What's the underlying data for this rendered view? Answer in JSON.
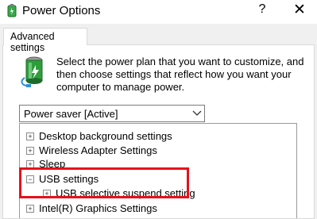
{
  "window": {
    "title": "Power Options",
    "help_glyph": "?",
    "close_glyph": "✕"
  },
  "tabs": [
    {
      "label": "Advanced settings"
    }
  ],
  "description": "Select the power plan that you want to customize, and then choose settings that reflect how you want your computer to manage power.",
  "plan_select": {
    "value": "Power saver [Active]"
  },
  "settings_tree": [
    {
      "label": "Desktop background settings",
      "state": "collapsed"
    },
    {
      "label": "Wireless Adapter Settings",
      "state": "collapsed"
    },
    {
      "label": "Sleep",
      "state": "collapsed"
    },
    {
      "label": "USB settings",
      "state": "expanded"
    },
    {
      "label": "USB selective suspend setting",
      "state": "collapsed"
    },
    {
      "label": "Intel(R) Graphics Settings",
      "state": "collapsed"
    }
  ],
  "expander_glyphs": {
    "collapsed": "+",
    "expanded": "−"
  },
  "colors": {
    "highlight": "#e8101a",
    "battery": "#2e9e3a"
  }
}
